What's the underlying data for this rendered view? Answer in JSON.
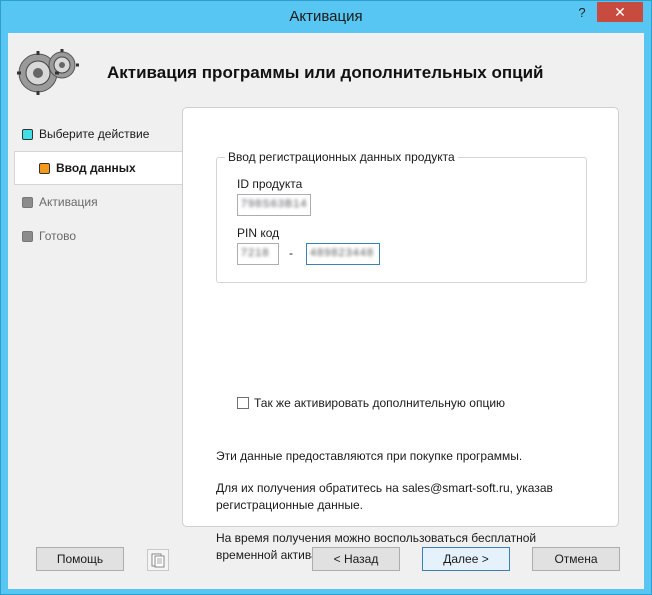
{
  "window": {
    "title": "Активация",
    "help_glyph": "?",
    "close_glyph": "✕"
  },
  "header": {
    "title": "Активация программы или дополнительных опций",
    "logo_icon": "gears-icon"
  },
  "steps": [
    {
      "label": "Выберите действие",
      "color": "#40e0e8",
      "state": "done"
    },
    {
      "label": "Ввод данных",
      "color": "#f39a1c",
      "state": "current"
    },
    {
      "label": "Активация",
      "color": "#8c8c8c",
      "state": "pending"
    },
    {
      "label": "Готово",
      "color": "#8c8c8c",
      "state": "pending"
    }
  ],
  "form": {
    "group_label": "Ввод регистрационных данных продукта",
    "product_id_label": "ID продукта",
    "product_id_value": "798S63B14",
    "pin_label": "PIN код",
    "pin_part1": "7218",
    "pin_dash": "-",
    "pin_part2": "489823448",
    "checkbox_label": "Так же активировать дополнительную опцию",
    "checkbox_checked": false
  },
  "info": {
    "line1": "Эти данные предоставляются при покупке программы.",
    "line2": "Для их получения обратитесь на sales@smart-soft.ru, указав регистрационные данные.",
    "line3": "На время получения можно воспользоваться бесплатной временной активацией."
  },
  "buttons": {
    "help": "Помощь",
    "back": "< Назад",
    "next": "Далее >",
    "cancel": "Отмена",
    "clipboard_icon": "clipboard-icon"
  }
}
